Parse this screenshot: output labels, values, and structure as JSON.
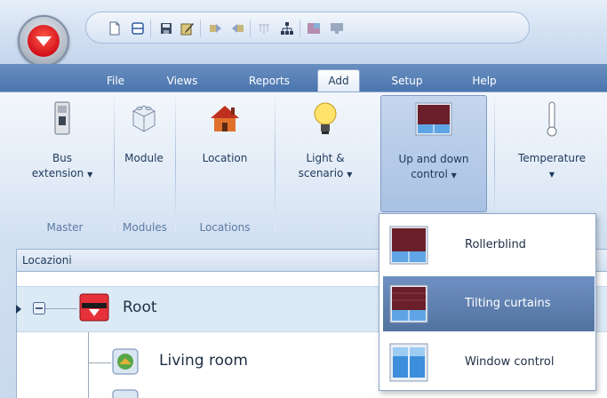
{
  "menu_tabs": [
    {
      "label": "File"
    },
    {
      "label": "Views"
    },
    {
      "label": "Reports"
    },
    {
      "label": "Add",
      "active": true
    },
    {
      "label": "Setup"
    },
    {
      "label": "Help"
    }
  ],
  "ribbon": {
    "groups": [
      {
        "label": "Master"
      },
      {
        "label": "Modules"
      },
      {
        "label": "Locations"
      }
    ],
    "buttons": {
      "bus_extension": {
        "line1": "Bus",
        "line2": "extension"
      },
      "module": {
        "label": "Module"
      },
      "location": {
        "label": "Location"
      },
      "light_scenario": {
        "line1": "Light &",
        "line2": "scenario"
      },
      "up_down_control": {
        "line1": "Up and down",
        "line2": "control"
      },
      "temperature": {
        "label": "Temperature"
      }
    }
  },
  "panel": {
    "title": "Locazioni"
  },
  "tree": {
    "root": {
      "label": "Root"
    },
    "items": [
      {
        "label": "Living room"
      }
    ]
  },
  "dropdown": {
    "items": [
      {
        "label": "Rollerblind",
        "highlighted": false
      },
      {
        "label": "Tilting curtains",
        "highlighted": true
      },
      {
        "label": "Window control",
        "highlighted": false
      }
    ]
  },
  "colors": {
    "accent_red": "#d3101a",
    "tab_bar": "#4a74ad",
    "highlight": "#5f80b3"
  }
}
